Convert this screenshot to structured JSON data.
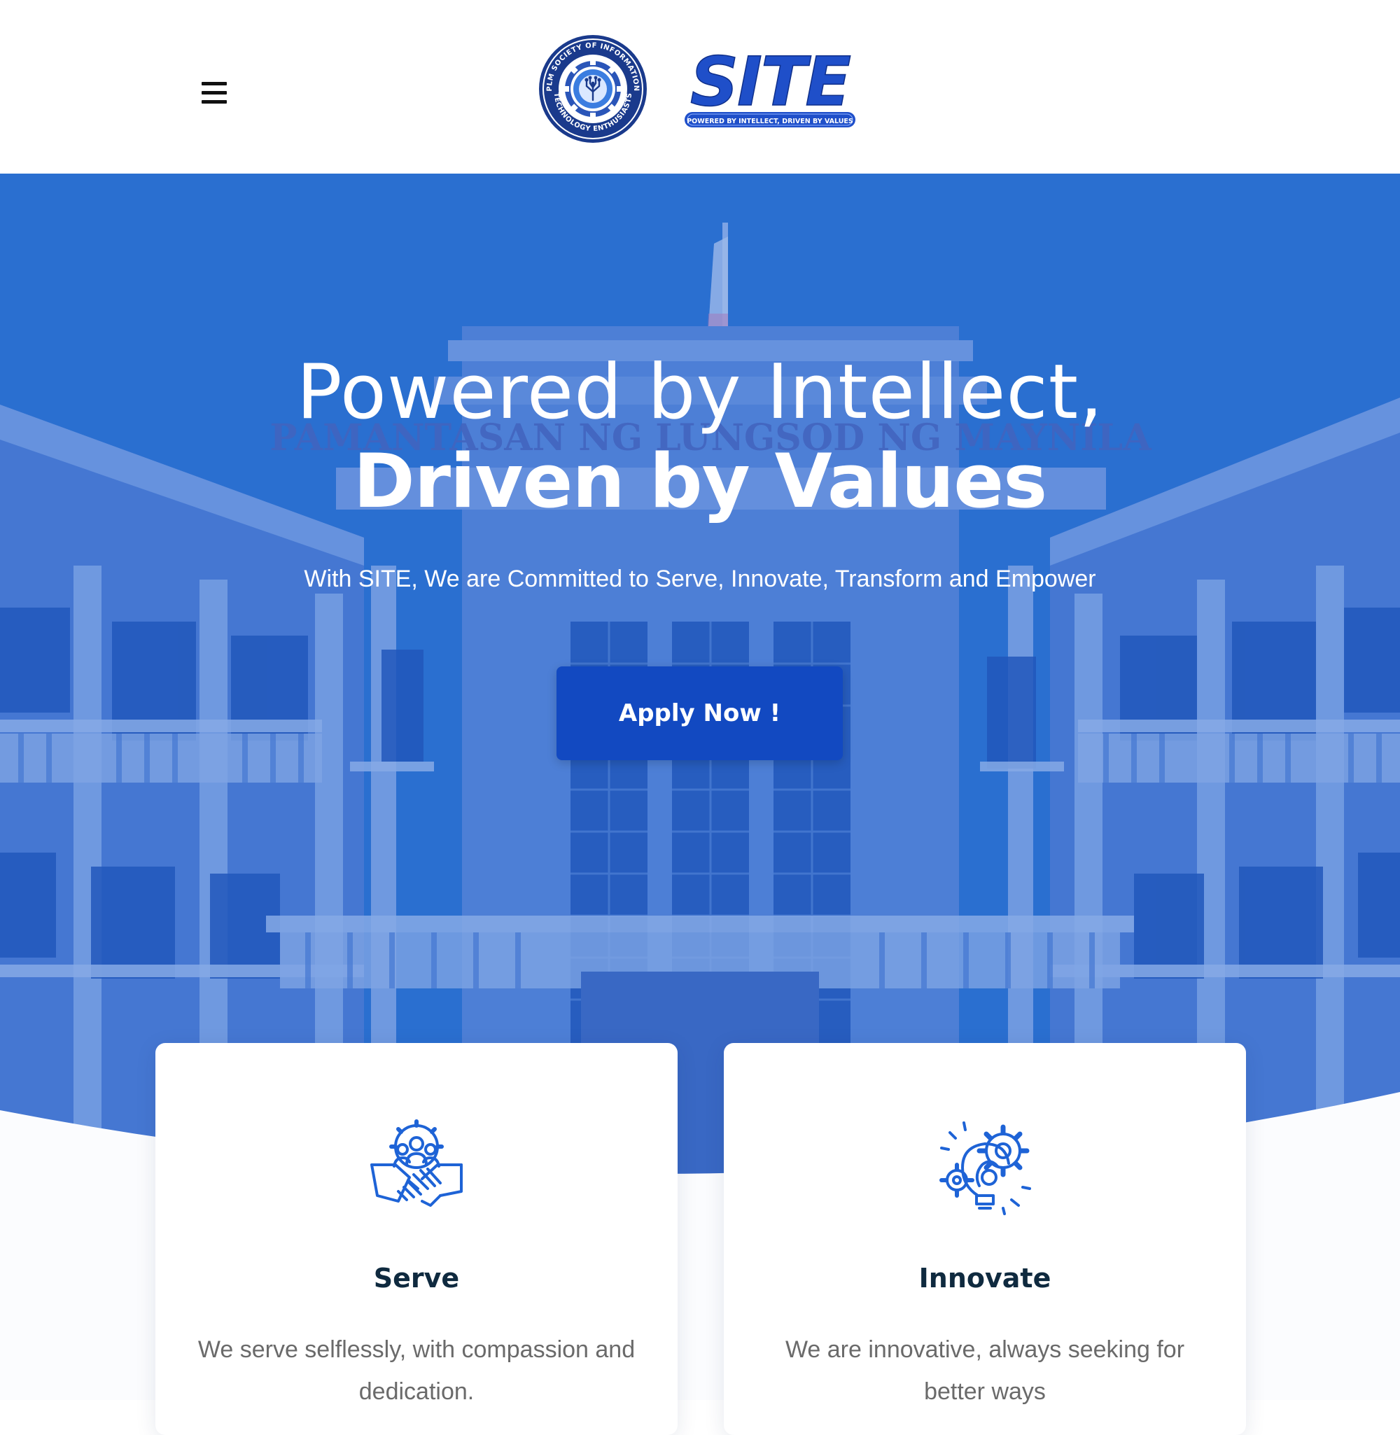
{
  "header": {
    "menu_icon": "hamburger-menu-icon",
    "seal": {
      "ring_text_top": "PLM SOCIETY OF INFORMATION",
      "ring_text_bottom": "TECHNOLOGY ENTHUSIASTS"
    },
    "logo": {
      "wordmark": "SITE",
      "tagline": "POWERED BY INTELLECT, DRIVEN BY VALUES"
    }
  },
  "hero": {
    "title_line1": "Powered by Intellect,",
    "title_line2": "Driven by Values",
    "subtitle": "With SITE, We are Committed to Serve, Innovate, Transform and Empower",
    "cta_label": "Apply Now !",
    "background_sign": "PAMANTASAN NG LUNGSOD NG MAYNILA",
    "overlay_color": "#2a6fd0",
    "button_color": "#1249c1"
  },
  "cards": [
    {
      "title": "Serve",
      "text": "We serve selflessly, with compassion and dedication.",
      "icon": "teamwork-handshake-icon"
    },
    {
      "title": "Innovate",
      "text": "We are innovative, always seeking for better ways",
      "icon": "lightbulb-gears-icon"
    }
  ],
  "colors": {
    "accent": "#1249c1",
    "icon_blue": "#1e63d6",
    "heading": "#0f2a3f",
    "body_text": "#6a6a6a"
  }
}
